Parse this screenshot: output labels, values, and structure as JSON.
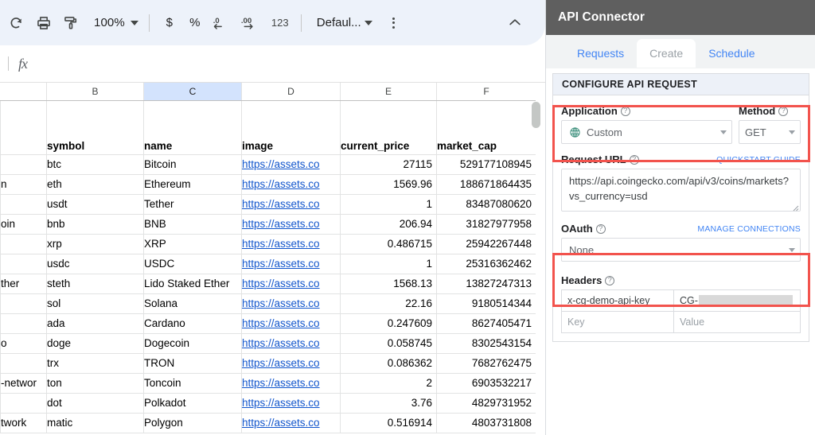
{
  "spreadsheet": {
    "toolbar": {
      "redo_label": "Redo",
      "print_label": "Print",
      "paint_format_label": "Paint format",
      "zoom_value": "100%",
      "currency_label": "$",
      "percent_label": "%",
      "decrease_decimal_label": ".0",
      "increase_decimal_label": ".00",
      "number_format_label": "123",
      "font_label": "Defaul...",
      "more_label": "More",
      "collapse_label": "Hide the menus"
    },
    "formula_bar": {
      "fx_label": "fx",
      "value": "",
      "placeholder": ""
    },
    "grid": {
      "column_letters": [
        "",
        "B",
        "C",
        "D",
        "E",
        "F"
      ],
      "selected_column": "C",
      "header_row": [
        "",
        "symbol",
        "name",
        "image",
        "current_price",
        "market_cap"
      ],
      "link_text": "https://assets.co",
      "rows": [
        {
          "a": "",
          "symbol": "btc",
          "name": "Bitcoin",
          "image": "https://assets.co",
          "current_price": "27115",
          "market_cap": "529177108945"
        },
        {
          "a": "n",
          "symbol": "eth",
          "name": "Ethereum",
          "image": "https://assets.co",
          "current_price": "1569.96",
          "market_cap": "188671864435"
        },
        {
          "a": "",
          "symbol": "usdt",
          "name": "Tether",
          "image": "https://assets.co",
          "current_price": "1",
          "market_cap": "83487080620"
        },
        {
          "a": "oin",
          "symbol": "bnb",
          "name": "BNB",
          "image": "https://assets.co",
          "current_price": "206.94",
          "market_cap": "31827977958"
        },
        {
          "a": "",
          "symbol": "xrp",
          "name": "XRP",
          "image": "https://assets.co",
          "current_price": "0.486715",
          "market_cap": "25942267448"
        },
        {
          "a": "",
          "symbol": "usdc",
          "name": "USDC",
          "image": "https://assets.co",
          "current_price": "1",
          "market_cap": "25316362462"
        },
        {
          "a": "ther",
          "symbol": "steth",
          "name": "Lido Staked Ether",
          "image": "https://assets.co",
          "current_price": "1568.13",
          "market_cap": "13827247313"
        },
        {
          "a": "",
          "symbol": "sol",
          "name": "Solana",
          "image": "https://assets.co",
          "current_price": "22.16",
          "market_cap": "9180514344"
        },
        {
          "a": "",
          "symbol": "ada",
          "name": "Cardano",
          "image": "https://assets.co",
          "current_price": "0.247609",
          "market_cap": "8627405471"
        },
        {
          "a": "o",
          "symbol": "doge",
          "name": "Dogecoin",
          "image": "https://assets.co",
          "current_price": "0.058745",
          "market_cap": "8302543154"
        },
        {
          "a": "",
          "symbol": "trx",
          "name": "TRON",
          "image": "https://assets.co",
          "current_price": "0.086362",
          "market_cap": "7682762475"
        },
        {
          "a": "-networ",
          "symbol": "ton",
          "name": "Toncoin",
          "image": "https://assets.co",
          "current_price": "2",
          "market_cap": "6903532217"
        },
        {
          "a": "",
          "symbol": "dot",
          "name": "Polkadot",
          "image": "https://assets.co",
          "current_price": "3.76",
          "market_cap": "4829731952"
        },
        {
          "a": "twork",
          "symbol": "matic",
          "name": "Polygon",
          "image": "https://assets.co",
          "current_price": "0.516914",
          "market_cap": "4803731808"
        }
      ]
    }
  },
  "sidebar": {
    "title": "API Connector",
    "tabs": [
      {
        "label": "Requests",
        "active": false
      },
      {
        "label": "Create",
        "active": true
      },
      {
        "label": "Schedule",
        "active": false
      }
    ],
    "configure_panel": {
      "heading": "CONFIGURE API REQUEST",
      "application": {
        "label": "Application",
        "value": "Custom",
        "icon": "globe-icon"
      },
      "method": {
        "label": "Method",
        "value": "GET"
      },
      "request_url": {
        "label": "Request URL",
        "action_label": "QUICKSTART GUIDE",
        "value": "https://api.coingecko.com/api/v3/coins/markets?vs_currency=usd"
      },
      "oauth": {
        "label": "OAuth",
        "action_label": "MANAGE CONNECTIONS",
        "value": "None"
      },
      "headers": {
        "label": "Headers",
        "rows": [
          {
            "key": "x-cg-demo-api-key",
            "value": "CG-",
            "redacted": true
          },
          {
            "key": "Key",
            "value": "Value",
            "placeholder": true
          }
        ]
      }
    },
    "colors": {
      "header_bg": "#5f5f5f",
      "tab_link": "#4285f4",
      "panel_head_bg": "#edf1f8",
      "annotation": "#f2534d",
      "link": "#1155cc",
      "globe": "#3c8f7c"
    }
  }
}
